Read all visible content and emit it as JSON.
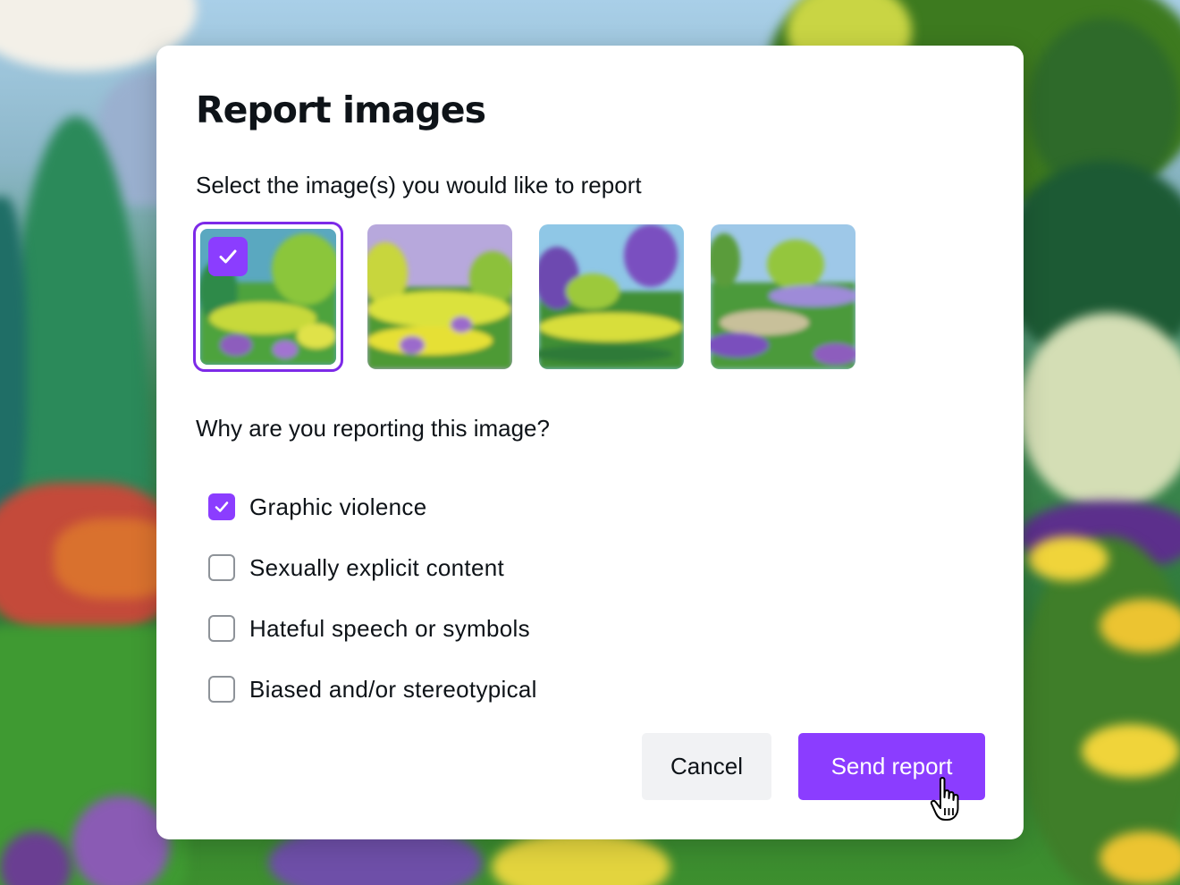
{
  "dialog": {
    "title": "Report images",
    "select_prompt": "Select the image(s) you would like to report",
    "reason_prompt": "Why are you reporting this image?",
    "images": [
      {
        "selected": true
      },
      {
        "selected": false
      },
      {
        "selected": false
      },
      {
        "selected": false
      }
    ],
    "reasons": [
      {
        "label": "Graphic violence",
        "checked": true
      },
      {
        "label": "Sexually explicit content",
        "checked": false
      },
      {
        "label": "Hateful speech or symbols",
        "checked": false
      },
      {
        "label": "Biased and/or stereotypical",
        "checked": false
      }
    ],
    "cancel_label": "Cancel",
    "send_label": "Send report"
  },
  "colors": {
    "accent": "#8b3dff",
    "selected_outline": "#7d2ae8",
    "cancel_bg": "#f1f2f4",
    "text": "#0e1318"
  },
  "icons": {
    "check": "checkmark-icon",
    "cursor": "hand-pointer-icon"
  }
}
